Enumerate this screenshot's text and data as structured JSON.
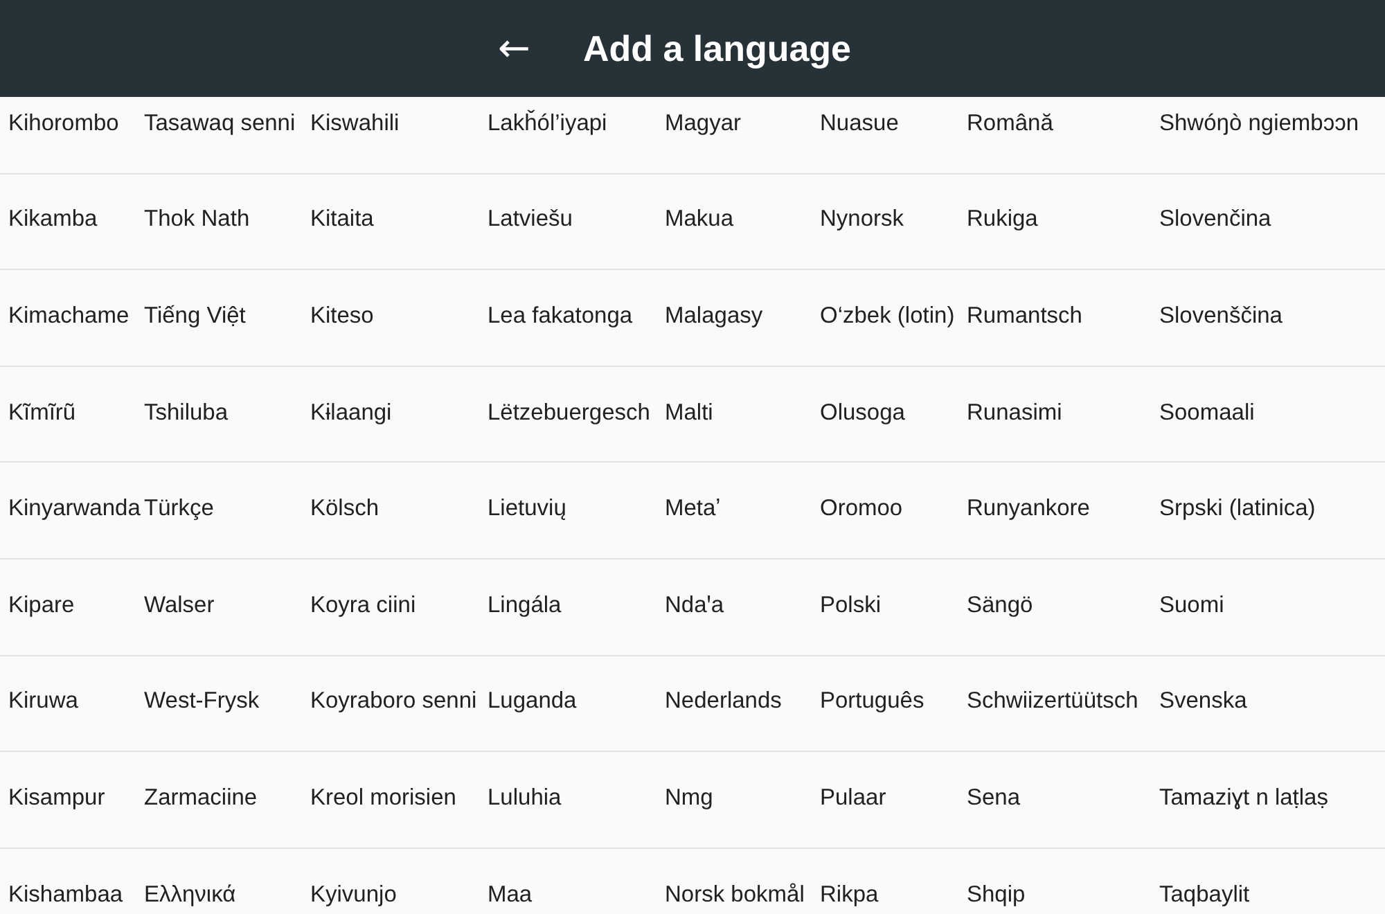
{
  "header": {
    "back_icon": "←",
    "title": "Add a language"
  },
  "rows": [
    [
      "Kihorombo",
      "Tasawaq senni",
      "Kiswahili",
      "Lakȟól’iyapi",
      "Magyar",
      "Nuasue",
      "Română",
      "Shwóŋò ngiembɔɔn"
    ],
    [
      "Kikamba",
      "Thok Nath",
      "Kitaita",
      "Latviešu",
      "Makua",
      "Nynorsk",
      "Rukiga",
      "Slovenčina"
    ],
    [
      "Kimachame",
      "Tiếng Việt",
      "Kiteso",
      "Lea fakatonga",
      "Malagasy",
      "O‘zbek (lotin)",
      "Rumantsch",
      "Slovenščina"
    ],
    [
      "Kĩmĩrũ",
      "Tshiluba",
      "Kɨlaangi",
      "Lëtzebuergesch",
      "Malti",
      "Olusoga",
      "Runasimi",
      "Soomaali"
    ],
    [
      "Kinyarwanda",
      "Türkçe",
      "Kölsch",
      "Lietuvių",
      "Metaʼ",
      "Oromoo",
      "Runyankore",
      "Srpski (latinica)"
    ],
    [
      "Kipare",
      "Walser",
      "Koyra ciini",
      "Lingála",
      "Ndaꞌa",
      "Polski",
      "Sängö",
      "Suomi"
    ],
    [
      "Kiruwa",
      "West-Frysk",
      "Koyraboro senni",
      "Luganda",
      "Nederlands",
      "Português",
      "Schwiizertüütsch",
      "Svenska"
    ],
    [
      "Kisampur",
      "Zarmaciine",
      "Kreol morisien",
      "Luluhia",
      "Nmg",
      "Pulaar",
      "Sena",
      "Tamaziɣt n laṭlaṣ"
    ],
    [
      "Kishambaa",
      "Ελληνικά",
      "Kyivunjo",
      "Maa",
      "Norsk bokmål",
      "Rikpa",
      "Shqip",
      "Taqbaylit"
    ]
  ]
}
